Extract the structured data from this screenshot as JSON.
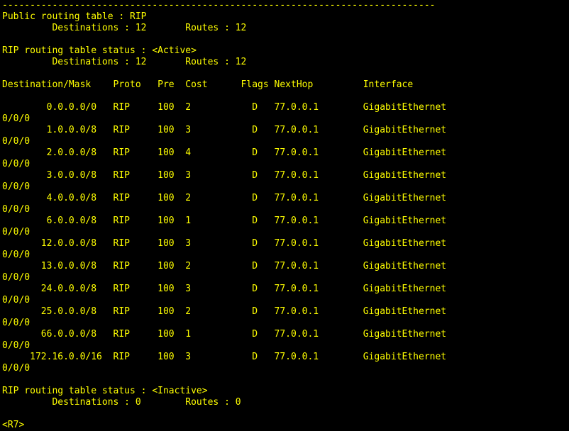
{
  "terminal": {
    "colors": {
      "background": "#000000",
      "foreground": "#ffff00"
    },
    "separator": "------------------------------------------------------------------------------",
    "public_table_header": "Public routing table : RIP",
    "public_counts": "         Destinations : 12       Routes : 12",
    "active_status": "RIP routing table status : <Active>",
    "active_counts": "         Destinations : 12       Routes : 12",
    "column_header": "Destination/Mask    Proto   Pre  Cost      Flags NextHop         Interface",
    "routes": [
      {
        "entry": "        0.0.0.0/0   RIP     100  2           D   77.0.0.1        GigabitEthernet",
        "cont": "0/0/0"
      },
      {
        "entry": "        1.0.0.0/8   RIP     100  3           D   77.0.0.1        GigabitEthernet",
        "cont": "0/0/0"
      },
      {
        "entry": "        2.0.0.0/8   RIP     100  4           D   77.0.0.1        GigabitEthernet",
        "cont": "0/0/0"
      },
      {
        "entry": "        3.0.0.0/8   RIP     100  3           D   77.0.0.1        GigabitEthernet",
        "cont": "0/0/0"
      },
      {
        "entry": "        4.0.0.0/8   RIP     100  2           D   77.0.0.1        GigabitEthernet",
        "cont": "0/0/0"
      },
      {
        "entry": "        6.0.0.0/8   RIP     100  1           D   77.0.0.1        GigabitEthernet",
        "cont": "0/0/0"
      },
      {
        "entry": "       12.0.0.0/8   RIP     100  3           D   77.0.0.1        GigabitEthernet",
        "cont": "0/0/0"
      },
      {
        "entry": "       13.0.0.0/8   RIP     100  2           D   77.0.0.1        GigabitEthernet",
        "cont": "0/0/0"
      },
      {
        "entry": "       24.0.0.0/8   RIP     100  3           D   77.0.0.1        GigabitEthernet",
        "cont": "0/0/0"
      },
      {
        "entry": "       25.0.0.0/8   RIP     100  2           D   77.0.0.1        GigabitEthernet",
        "cont": "0/0/0"
      },
      {
        "entry": "       66.0.0.0/8   RIP     100  1           D   77.0.0.1        GigabitEthernet",
        "cont": "0/0/0"
      },
      {
        "entry": "     172.16.0.0/16  RIP     100  3           D   77.0.0.1        GigabitEthernet",
        "cont": "0/0/0"
      }
    ],
    "inactive_status": "RIP routing table status : <Inactive>",
    "inactive_counts": "         Destinations : 0        Routes : 0",
    "prompt": "<R7>"
  }
}
